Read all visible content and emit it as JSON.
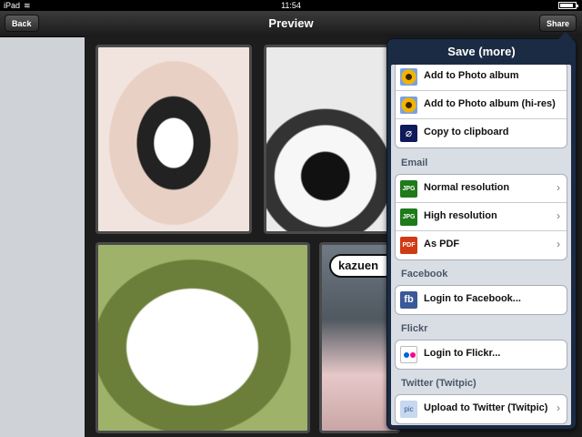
{
  "status_bar": {
    "carrier": "iPad",
    "wifi_icon": "wifi-icon",
    "time": "11:54",
    "battery_level": 0.9
  },
  "navbar": {
    "title": "Preview",
    "back_label": "Back",
    "share_label": "Share"
  },
  "canvas": {
    "bubble_text": "kazuen"
  },
  "popover": {
    "title": "Save (more)",
    "photo_group": [
      {
        "label": "Add to Photo album",
        "icon": "flower-icon"
      },
      {
        "label": "Add to Photo album (hi-res)",
        "icon": "flower-icon"
      },
      {
        "label": "Copy to clipboard",
        "icon": "paperclip-icon"
      }
    ],
    "email": {
      "header": "Email",
      "items": [
        {
          "label": "Normal resolution",
          "icon_text": "JPG"
        },
        {
          "label": "High resolution",
          "icon_text": "JPG"
        },
        {
          "label": "As PDF",
          "icon_text": "PDF"
        }
      ]
    },
    "facebook": {
      "header": "Facebook",
      "label": "Login to Facebook...",
      "icon_text": "fb"
    },
    "flickr": {
      "header": "Flickr",
      "label": "Login to Flickr..."
    },
    "twitter": {
      "header": "Twitter (Twitpic)",
      "label": "Upload to Twitter (Twitpic)",
      "icon_text": "pic"
    }
  },
  "colors": {
    "navbar": "#2a2a2a",
    "popover": "#1b2b44",
    "facebook": "#3b5998",
    "jpg_green": "#1e7a1a",
    "pdf_red": "#d23a14"
  }
}
